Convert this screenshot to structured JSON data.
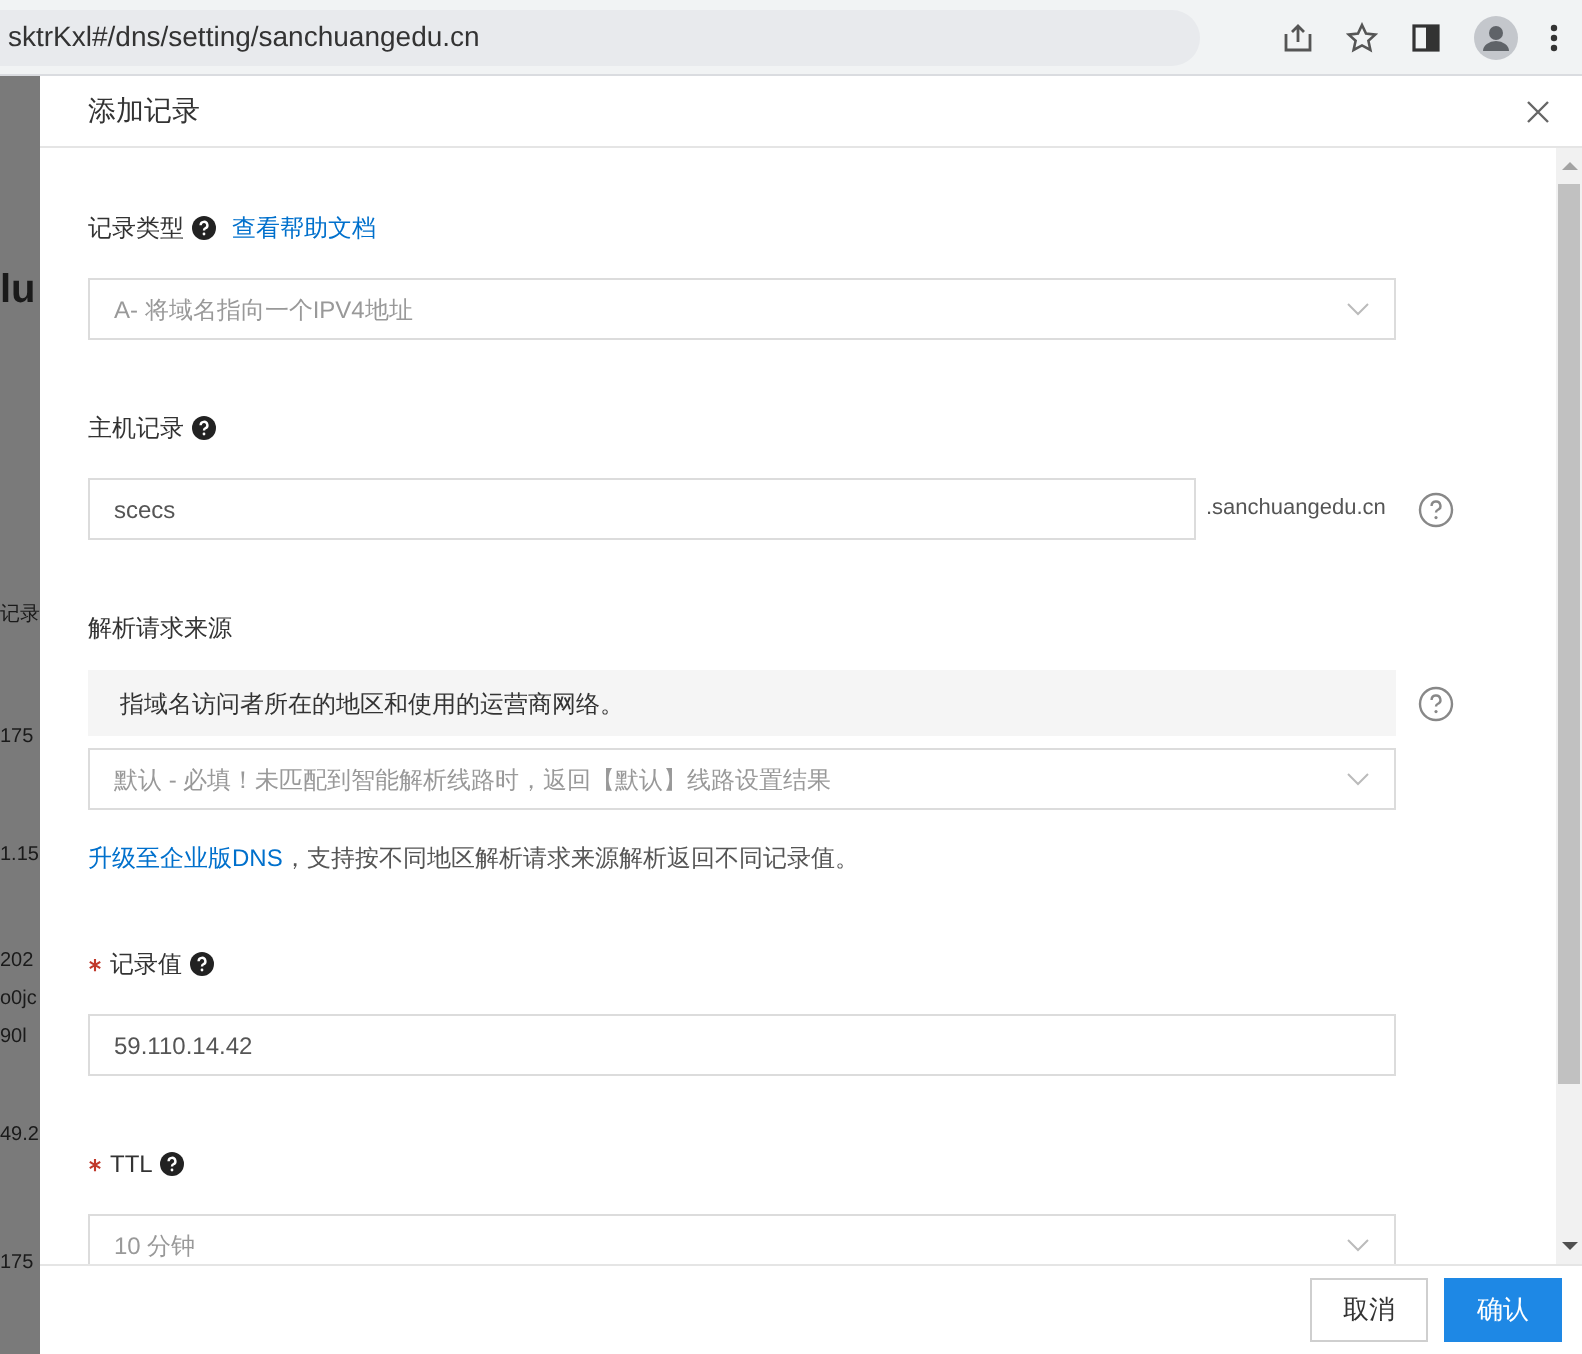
{
  "browser": {
    "url": "sktrKxl#/dns/setting/sanchuangedu.cn"
  },
  "background_fragments": [
    {
      "text": "lu",
      "kind": "heading"
    },
    {
      "text": "记录",
      "kind": "text"
    },
    {
      "text": "175",
      "kind": "text"
    },
    {
      "text": "1.15",
      "kind": "text"
    },
    {
      "text": "202",
      "kind": "text"
    },
    {
      "text": "o0jc",
      "kind": "text"
    },
    {
      "text": "90l",
      "kind": "text"
    },
    {
      "text": "49.2",
      "kind": "text"
    },
    {
      "text": "175",
      "kind": "text"
    }
  ],
  "dialog": {
    "title": "添加记录",
    "fields": [
      {
        "kind": "select",
        "label": "记录类型",
        "required": false,
        "help": true,
        "link": "查看帮助文档",
        "value": "A- 将域名指向一个IPV4地址"
      },
      {
        "kind": "input",
        "label": "主机记录",
        "required": false,
        "help": true,
        "value": "scecs",
        "suffix": ".sanchuangedu.cn"
      },
      {
        "kind": "select",
        "label": "解析请求来源",
        "required": false,
        "help": false,
        "info": "指域名访问者所在的地区和使用的运营商网络。",
        "value": "默认 - 必填！未匹配到智能解析线路时，返回【默认】线路设置结果",
        "note_link": "升级至企业版DNS",
        "note": "，支持按不同地区解析请求来源解析返回不同记录值。"
      },
      {
        "kind": "input",
        "label": "记录值",
        "required": true,
        "help": true,
        "value": "59.110.14.42"
      },
      {
        "kind": "select",
        "label": "TTL",
        "required": true,
        "help": true,
        "value": "10 分钟"
      }
    ],
    "buttons": [
      {
        "label": "取消",
        "primary": false
      },
      {
        "label": "确认",
        "primary": true
      }
    ]
  }
}
